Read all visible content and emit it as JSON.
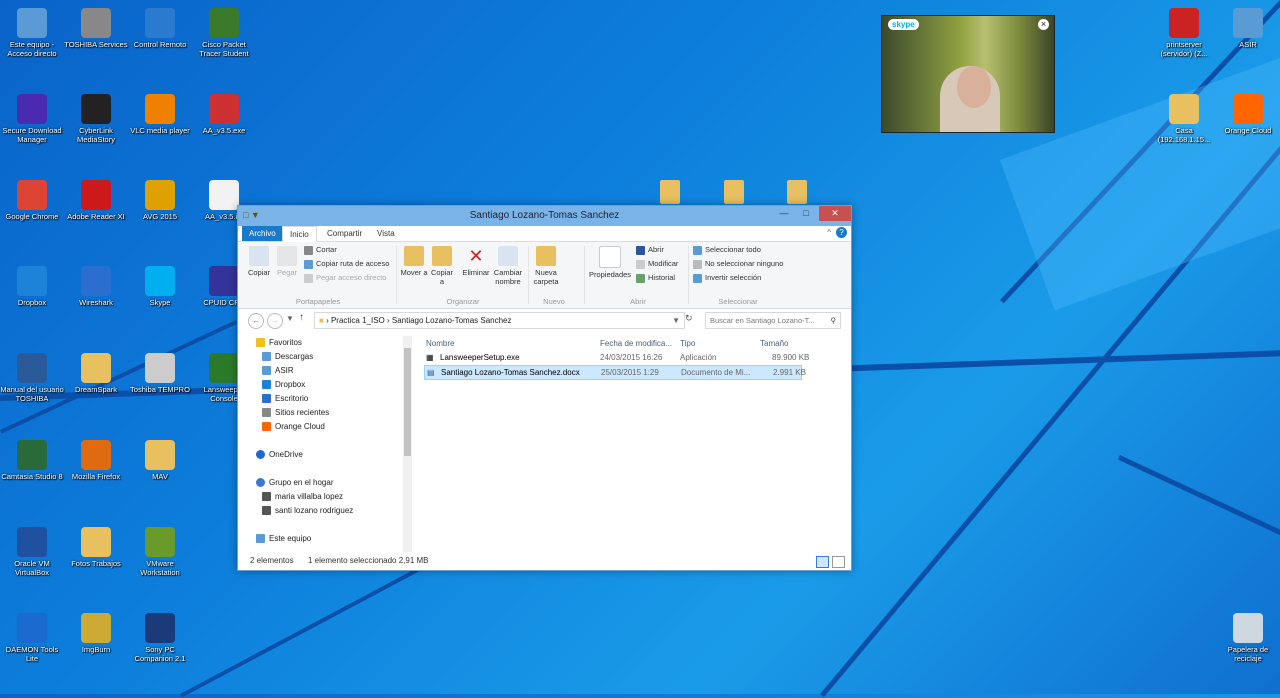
{
  "colors": {
    "accent": "#1979ca",
    "desktop": "#0d7fdc",
    "selection": "#cce8ff"
  },
  "desktop_icons": [
    {
      "label": "Este equipo - Acceso directo",
      "icon": "computer-icon",
      "color": "#5b9bd5"
    },
    {
      "label": "TOSHIBA Services",
      "icon": "toshiba-icon",
      "color": "#888888"
    },
    {
      "label": "Control Remoto",
      "icon": "globe-icon",
      "color": "#2a7ad0"
    },
    {
      "label": "Cisco Packet Tracer Student",
      "icon": "cisco-icon",
      "color": "#3a7a2a"
    },
    {
      "label": "Secure Download Manager",
      "icon": "download-icon",
      "color": "#4a2ab0"
    },
    {
      "label": "CyberLink MediaStory",
      "icon": "cyberlink-icon",
      "color": "#222222"
    },
    {
      "label": "VLC media player",
      "icon": "vlc-icon",
      "color": "#f08000"
    },
    {
      "label": "AA_v3.5.exe",
      "icon": "app-icon",
      "color": "#cc3030"
    },
    {
      "label": "Google Chrome",
      "icon": "chrome-icon",
      "color": "#dd4433"
    },
    {
      "label": "Adobe Reader XI",
      "icon": "adobe-icon",
      "color": "#cc1a1a"
    },
    {
      "label": "AVG 2015",
      "icon": "avg-icon",
      "color": "#e0a000"
    },
    {
      "label": "AA_v3.5.ini",
      "icon": "file-icon",
      "color": "#f2f2f2"
    },
    {
      "label": "Dropbox",
      "icon": "dropbox-icon",
      "color": "#1c84d8"
    },
    {
      "label": "Wireshark",
      "icon": "wireshark-icon",
      "color": "#2a6fd0"
    },
    {
      "label": "Skype",
      "icon": "skype-icon",
      "color": "#00aff0"
    },
    {
      "label": "CPUID CPU",
      "icon": "cpuid-icon",
      "color": "#333399"
    },
    {
      "label": "Manual del usuario TOSHIBA",
      "icon": "manual-icon",
      "color": "#2a5a9a"
    },
    {
      "label": "DreamSpark",
      "icon": "folder-icon",
      "color": "#e8c060"
    },
    {
      "label": "Toshiba TEMPRO",
      "icon": "tempro-icon",
      "color": "#cccccc"
    },
    {
      "label": "Lansweeper Console",
      "icon": "lansweeper-icon",
      "color": "#2a7a2a"
    },
    {
      "label": "Camtasia Studio 8",
      "icon": "camtasia-icon",
      "color": "#2a6a3a"
    },
    {
      "label": "Mozilla Firefox",
      "icon": "firefox-icon",
      "color": "#e06a10"
    },
    {
      "label": "MAV",
      "icon": "folder-icon",
      "color": "#e8c060"
    },
    {
      "label": "Oracle VM VirtualBox",
      "icon": "virtualbox-icon",
      "color": "#2050a0"
    },
    {
      "label": "Fotos Trabajos",
      "icon": "folder-icon",
      "color": "#e8c060"
    },
    {
      "label": "VMware Workstation",
      "icon": "vmware-icon",
      "color": "#6a9a2a"
    },
    {
      "label": "DAEMON Tools Lite",
      "icon": "daemon-icon",
      "color": "#1a6ad0"
    },
    {
      "label": "ImgBurn",
      "icon": "imgburn-icon",
      "color": "#ccaa33"
    },
    {
      "label": "Sony PC Companion 2.1",
      "icon": "sony-icon",
      "color": "#1a3a7a"
    },
    {
      "label": "printserver (servidor) (Z...",
      "icon": "printer-icon",
      "color": "#cc2222"
    },
    {
      "label": "ASIR",
      "icon": "network-icon",
      "color": "#5b9bd5"
    },
    {
      "label": "Casa (192.168.1.15...",
      "icon": "folder-icon",
      "color": "#e8c060"
    },
    {
      "label": "Orange Cloud",
      "icon": "cloud-folder-icon",
      "color": "#ff6600"
    },
    {
      "label": "Papelera de reciclaje",
      "icon": "recycle-bin-icon",
      "color": "#cfd8e0"
    }
  ],
  "skype": {
    "logo": "skype"
  },
  "window": {
    "title": "Santiago Lozano-Tomas Sanchez",
    "tabs": [
      "Archivo",
      "Inicio",
      "Compartir",
      "Vista"
    ],
    "ribbon": {
      "copiar": "Copiar",
      "pegar": "Pegar",
      "cortar": "Cortar",
      "copiar_ruta": "Copiar ruta de acceso",
      "pegar_acceso": "Pegar acceso directo",
      "mover": "Mover a",
      "copiar_a": "Copiar a",
      "eliminar": "Eliminar",
      "cambiar": "Cambiar nombre",
      "nueva": "Nueva carpeta",
      "propiedades": "Propiedades",
      "abrir": "Abrir",
      "modificar": "Modificar",
      "historial": "Historial",
      "sel_todo": "Seleccionar todo",
      "no_sel": "No seleccionar ninguno",
      "invertir": "Invertir selección",
      "groups": [
        "Portapapeles",
        "Organizar",
        "Nuevo",
        "Abrir",
        "Seleccionar"
      ]
    },
    "breadcrumb": [
      "Practica 1_ISO",
      "Santiago Lozano-Tomas Sanchez"
    ],
    "search_placeholder": "Buscar en Santiago Lozano-T...",
    "nav_pane": {
      "favoritos": "Favoritos",
      "favorites": [
        "Descargas",
        "ASIR",
        "Dropbox",
        "Escritorio",
        "Sitios recientes",
        "Orange Cloud"
      ],
      "onedrive": "OneDrive",
      "grupo": "Grupo en el hogar",
      "homegroup": [
        "maria villalba lopez",
        "santi lozano rodriguez"
      ],
      "equipo": "Este equipo"
    },
    "columns": {
      "nombre": "Nombre",
      "fecha": "Fecha de modifica...",
      "tipo": "Tipo",
      "tamano": "Tamaño"
    },
    "files": [
      {
        "name": "LansweeperSetup.exe",
        "date": "24/03/2015 16:26",
        "type": "Aplicación",
        "size": "89.900 KB",
        "selected": false
      },
      {
        "name": "Santiago Lozano-Tomas Sanchez.docx",
        "date": "25/03/2015 1:29",
        "type": "Documento de Mi...",
        "size": "2.991 KB",
        "selected": true
      }
    ],
    "status": {
      "count": "2 elementos",
      "selected": "1 elemento seleccionado  2,91 MB"
    }
  }
}
